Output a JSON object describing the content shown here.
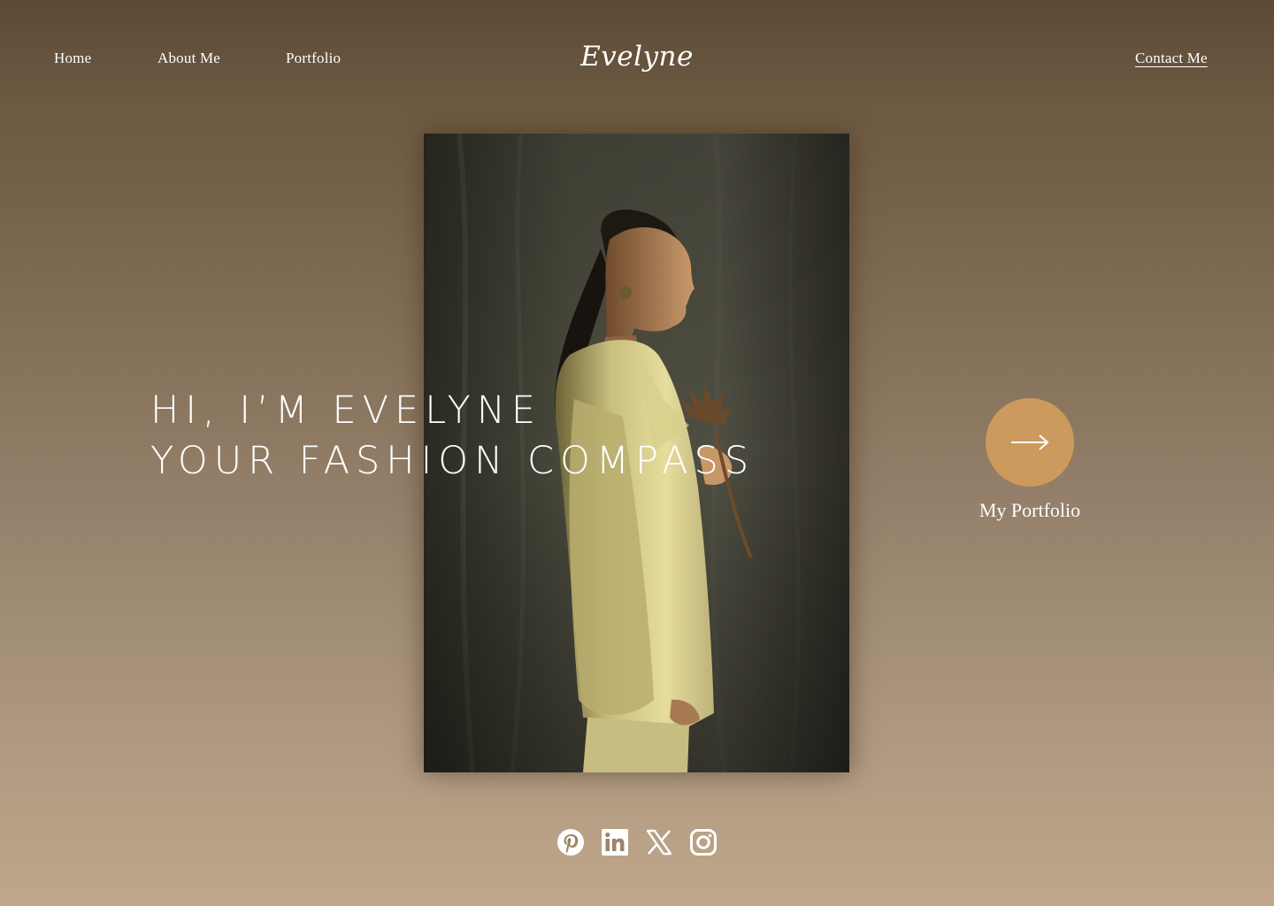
{
  "header": {
    "nav": [
      {
        "label": "Home"
      },
      {
        "label": "About Me"
      },
      {
        "label": "Portfolio"
      }
    ],
    "logo": "Evelyne",
    "contact_label": "Contact Me"
  },
  "hero": {
    "headline_line1": "HI, I’M EVELYNE",
    "headline_line2": "YOUR FASHION COMPASS",
    "photo_subject": "woman in cream suit holding dried flower"
  },
  "cta": {
    "label": "My Portfolio",
    "icon": "arrow-right-icon",
    "color": "#cc9a5c"
  },
  "social": [
    {
      "name": "pinterest-icon"
    },
    {
      "name": "linkedin-icon"
    },
    {
      "name": "x-icon"
    },
    {
      "name": "instagram-icon"
    }
  ],
  "colors": {
    "accent": "#cc9a5c",
    "background_top": "#5c4a35",
    "background_bottom": "#c0a78b",
    "text": "#ffffff"
  }
}
